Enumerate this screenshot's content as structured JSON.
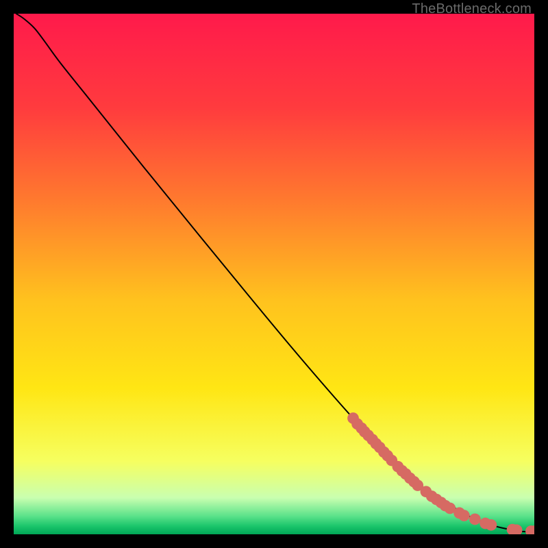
{
  "watermark": "TheBottleneck.com",
  "chart_data": {
    "type": "line",
    "title": "",
    "xlabel": "",
    "ylabel": "",
    "xlim": [
      0,
      100
    ],
    "ylim": [
      0,
      100
    ],
    "grid": false,
    "background_gradient": [
      {
        "stop": 0.0,
        "color": "#ff1a4b"
      },
      {
        "stop": 0.18,
        "color": "#ff3b3e"
      },
      {
        "stop": 0.36,
        "color": "#ff7a2e"
      },
      {
        "stop": 0.55,
        "color": "#ffc21e"
      },
      {
        "stop": 0.72,
        "color": "#ffe614"
      },
      {
        "stop": 0.86,
        "color": "#f6ff60"
      },
      {
        "stop": 0.93,
        "color": "#c9ffb0"
      },
      {
        "stop": 0.965,
        "color": "#5be28a"
      },
      {
        "stop": 0.985,
        "color": "#19c46a"
      },
      {
        "stop": 1.0,
        "color": "#00a656"
      }
    ],
    "series": [
      {
        "name": "curve",
        "type": "line",
        "color": "#000000",
        "x": [
          0.5,
          2,
          4,
          6,
          9,
          15,
          25,
          35,
          45,
          55,
          65,
          72,
          78,
          84,
          88,
          91,
          93.5,
          95.5,
          97,
          98.5,
          100
        ],
        "y": [
          100,
          99,
          97.2,
          94.6,
          90.5,
          83,
          70.5,
          58.2,
          46,
          34,
          22.5,
          15,
          9.5,
          5.5,
          3.2,
          2.0,
          1.3,
          0.9,
          0.6,
          0.5,
          0.5
        ]
      },
      {
        "name": "marker-cluster",
        "type": "scatter",
        "color": "#d66a63",
        "radius_world": 1.1,
        "x": [
          65.2,
          66.0,
          66.8,
          67.4,
          68.1,
          68.9,
          69.6,
          70.3,
          71.1,
          71.8,
          72.6,
          73.8,
          74.6,
          75.3,
          76.1,
          76.9,
          77.6,
          79.2,
          80.3,
          81.2,
          82.1,
          82.9,
          83.8,
          85.6,
          86.5,
          88.6,
          90.6,
          91.7,
          95.8,
          96.6,
          99.4,
          100.0
        ],
        "y": [
          22.3,
          21.2,
          20.4,
          19.7,
          19.0,
          18.2,
          17.4,
          16.7,
          15.8,
          15.1,
          14.2,
          13.0,
          12.2,
          11.6,
          10.8,
          10.1,
          9.4,
          8.2,
          7.3,
          6.7,
          6.1,
          5.5,
          5.0,
          4.1,
          3.6,
          2.9,
          2.1,
          1.8,
          0.9,
          0.8,
          0.6,
          0.6
        ]
      }
    ]
  }
}
